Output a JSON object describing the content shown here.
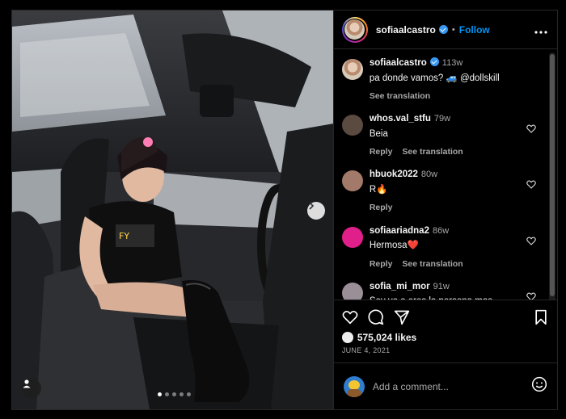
{
  "post": {
    "author": {
      "username": "sofiaalcastro",
      "verified": true,
      "follow_label": "Follow",
      "separator": "•"
    },
    "caption": {
      "username": "sofiaalcastro",
      "time": "113w",
      "text": "pa donde vamos? 🚙 @dollskill",
      "see_translation": "See translation"
    },
    "comments": [
      {
        "username": "whos.val_stfu",
        "time": "79w",
        "text": "Beia",
        "reply": "Reply",
        "translation": "See translation",
        "avatar_color": "#5b4a40"
      },
      {
        "username": "hbuok2022",
        "time": "80w",
        "text": "R🔥",
        "reply": "Reply",
        "translation": "",
        "avatar_color": "#a37a6a"
      },
      {
        "username": "sofiaariadna2",
        "time": "86w",
        "text": "Hermosa❤️",
        "reply": "Reply",
        "translation": "See translation",
        "avatar_color": "#e01f8a"
      },
      {
        "username": "sofia_mi_mor",
        "time": "91w",
        "text": "Soy yo o eres la persona mas",
        "reply": "",
        "translation": "",
        "avatar_color": "#9a8f96"
      }
    ],
    "likes": "575,024 likes",
    "date": "JUNE 4, 2021",
    "add_comment_placeholder": "Add a comment...",
    "carousel": {
      "count": 5,
      "active": 0
    }
  },
  "icons": {
    "more": "more-options-icon",
    "heart": "heart-icon",
    "comment": "comment-icon",
    "share": "share-icon",
    "save": "bookmark-icon",
    "emoji": "emoji-icon",
    "next": "chevron-right-icon",
    "user": "user-tag-icon"
  }
}
